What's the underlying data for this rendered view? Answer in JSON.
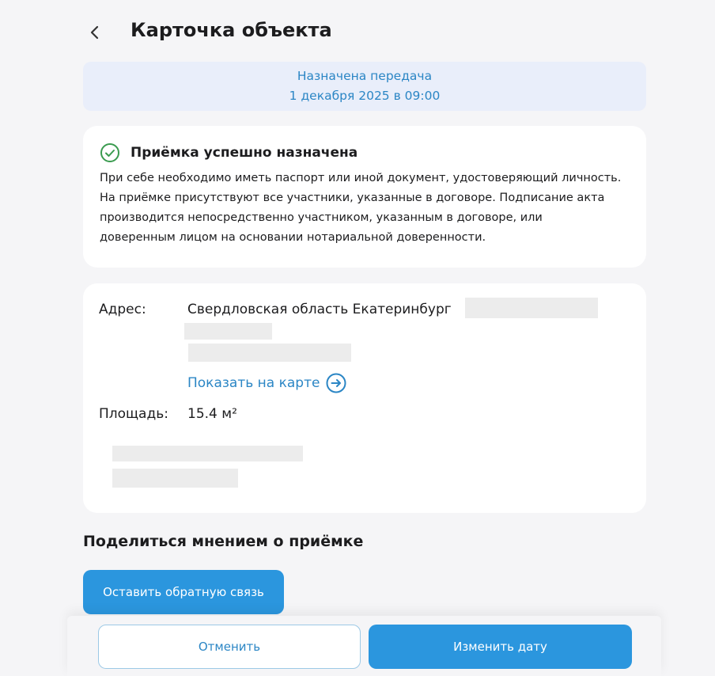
{
  "header": {
    "title": "Карточка объекта",
    "back_icon": "chevron-left-icon"
  },
  "banner": {
    "line1": "Назначена передача",
    "line2": "1 декабря 2025 в 09:00"
  },
  "success_card": {
    "icon": "check-circle-icon",
    "title": "Приёмка успешно назначена",
    "text": "При себе необходимо иметь паспорт или иной документ, удостоверяющий личность. На приёмке присутствуют все участники, указанные в договоре. Подписание акта производится непосредственно участником, указанным в договоре, или доверенным лицом на основании нотариальной доверенности.",
    "icon_color": "#3a9b4f"
  },
  "info_card": {
    "address_label": "Адрес:",
    "address_value": "Свердловская область Екатеринбург",
    "map_link": "Показать на карте",
    "map_link_icon": "arrow-right-circle-icon",
    "area_label": "Площадь:",
    "area_value": "15.4 м²"
  },
  "feedback": {
    "section_title": "Поделиться мнением о приёмке",
    "button_label": "Оставить обратную связь"
  },
  "bottom_bar": {
    "cancel_label": "Отменить",
    "change_label": "Изменить дату"
  },
  "colors": {
    "accent": "#2b96de",
    "link": "#2b86c5",
    "banner_bg": "#e9eefa",
    "page_bg": "#f5f5f7"
  }
}
